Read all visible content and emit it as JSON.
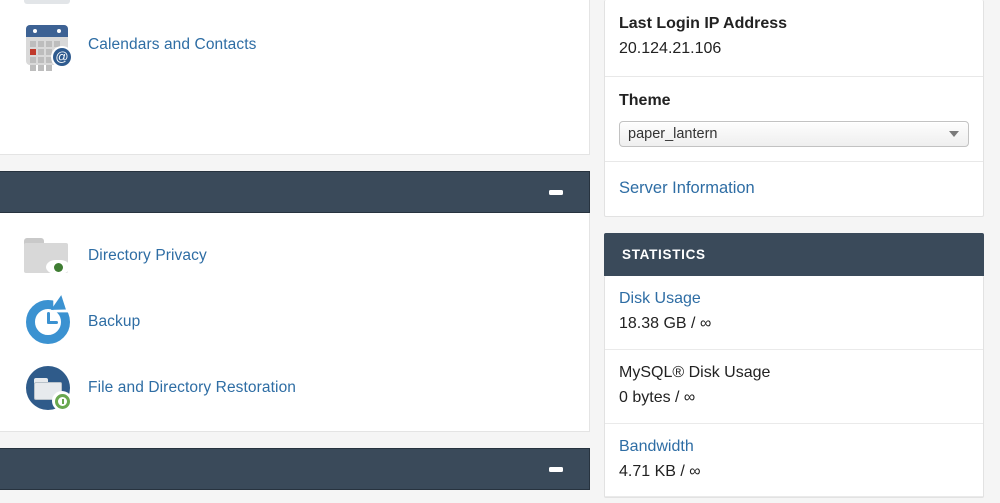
{
  "left_panel": {
    "sections": [
      {
        "name": "domains-section",
        "header_title": "",
        "minimize_label": "−",
        "items": [
          {
            "label": "Calendars and Contacts",
            "icon": "calendar-contacts-icon"
          }
        ]
      },
      {
        "name": "files-security-section",
        "header_title": "",
        "minimize_label": "−",
        "items": [
          {
            "label": "Directory Privacy",
            "icon": "folder-eye-icon"
          },
          {
            "label": "Backup",
            "icon": "backup-clock-icon"
          },
          {
            "label": "File and Directory Restoration",
            "icon": "file-restore-icon"
          }
        ]
      },
      {
        "name": "next-section",
        "header_title": "",
        "minimize_label": "−",
        "items": []
      }
    ]
  },
  "right_panel": {
    "general_info": {
      "last_login": {
        "title": "Last Login IP Address",
        "value": "20.124.21.106"
      },
      "theme": {
        "title": "Theme",
        "selected": "paper_lantern",
        "options": [
          "paper_lantern"
        ]
      },
      "server_information_link": "Server Information"
    },
    "statistics": {
      "header": "STATISTICS",
      "rows": [
        {
          "title": "Disk Usage",
          "value": "18.38 GB / ∞",
          "is_link": true
        },
        {
          "title": "MySQL® Disk Usage",
          "value": "0 bytes / ∞",
          "is_link": false
        },
        {
          "title": "Bandwidth",
          "value": "4.71 KB / ∞",
          "is_link": true
        }
      ]
    }
  },
  "colors": {
    "link": "#2e6da4",
    "dark_header": "#3a4a5a",
    "page_bg": "#f5f5f5",
    "card_bg": "#ffffff"
  }
}
